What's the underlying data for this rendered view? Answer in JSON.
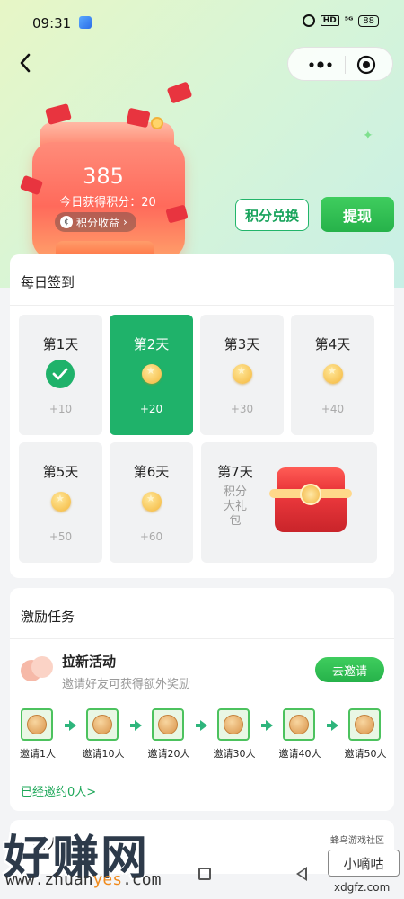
{
  "status_bar": {
    "time": "09:31",
    "hd": "HD",
    "signal": "⁵ᴳ",
    "battery": "88"
  },
  "nav": {
    "back_icon": "chevron-left-icon",
    "more_icon": "more-dots-icon",
    "target_icon": "target-icon"
  },
  "hero": {
    "points": "385",
    "today_points": "今日获得积分：20",
    "income_label": "积分收益",
    "income_arrow": "›",
    "exchange_label": "积分兑换",
    "withdraw_label": "提现"
  },
  "checkin": {
    "title": "每日签到",
    "days": [
      {
        "label": "第1天",
        "reward": "+10",
        "state": "done"
      },
      {
        "label": "第2天",
        "reward": "+20",
        "state": "active"
      },
      {
        "label": "第3天",
        "reward": "+30",
        "state": "pending"
      },
      {
        "label": "第4天",
        "reward": "+40",
        "state": "pending"
      },
      {
        "label": "第5天",
        "reward": "+50",
        "state": "pending"
      },
      {
        "label": "第6天",
        "reward": "+60",
        "state": "pending"
      }
    ],
    "day7": {
      "label": "第7天",
      "desc": "积分大礼包"
    }
  },
  "tasks": {
    "title": "激励任务",
    "invite": {
      "name": "拉新活动",
      "desc": "邀请好友可获得额外奖励",
      "button": "去邀请",
      "steps": [
        "邀请1人",
        "邀请10人",
        "邀请20人",
        "邀请30人",
        "邀请40人",
        "邀请50人"
      ],
      "invited": "已经邀约0人>"
    }
  },
  "partial_card": {
    "title": "新人福利"
  },
  "watermark": {
    "left_text": "好赚网",
    "url_prefix": "www.zhuan",
    "url_highlight": "yes",
    "url_suffix": ".com",
    "right_small": "蜂鸟游戏社区",
    "right_box": "小嘀咕",
    "right_url": "xdgfz.com"
  },
  "colors": {
    "primary_green": "#1fb26a",
    "accent_red": "#e8343f",
    "link_green": "#1fa85a"
  }
}
